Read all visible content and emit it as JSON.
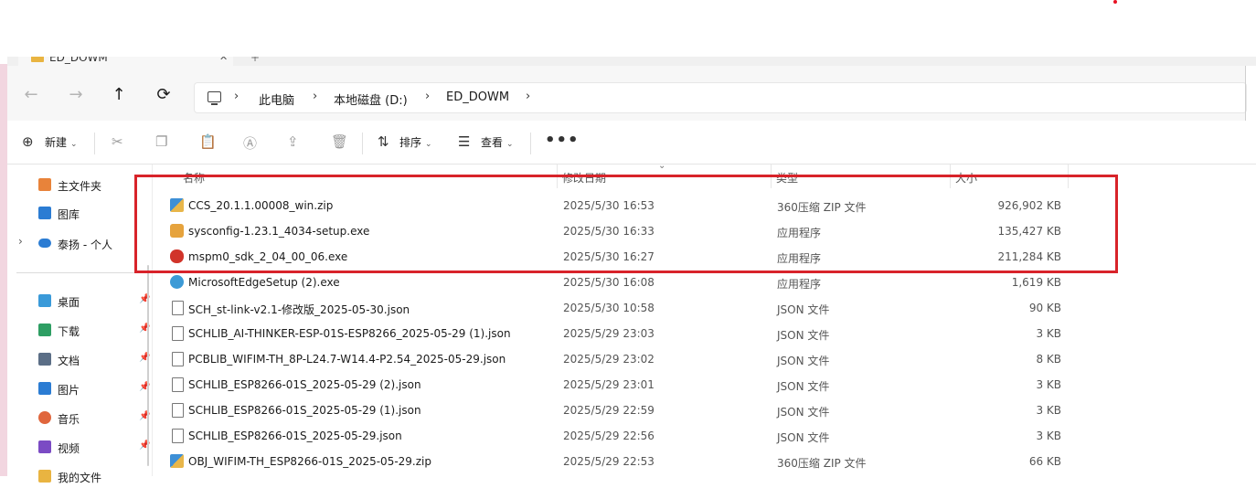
{
  "tab": {
    "title": "ED_DOWM",
    "close": "✕",
    "new_tab": "+"
  },
  "nav_buttons": {
    "back": "←",
    "forward": "→",
    "up": "↑",
    "refresh": "⟳"
  },
  "breadcrumb": {
    "items": [
      "此电脑",
      "本地磁盘 (D:)",
      "ED_DOWM"
    ],
    "separator": "›"
  },
  "toolbar": {
    "new_label": "新建",
    "sort_label": "排序",
    "view_label": "查看",
    "more_label": "•••",
    "icons": [
      "cut-icon",
      "copy-icon",
      "paste-icon",
      "rename-icon",
      "share-icon",
      "delete-icon"
    ]
  },
  "navpane": {
    "items": [
      {
        "label": "主文件夹",
        "icon": "home-icon",
        "color": "#e8833a"
      },
      {
        "label": "图库",
        "icon": "gallery-icon",
        "color": "#2b7cd3"
      },
      {
        "label": "泰扬 - 个人",
        "icon": "onedrive-icon",
        "color": "#2b7cd3"
      },
      {
        "label": "桌面",
        "icon": "desktop-icon",
        "color": "#3a9ad9"
      },
      {
        "label": "下载",
        "icon": "download-icon",
        "color": "#2e9e63"
      },
      {
        "label": "文档",
        "icon": "documents-icon",
        "color": "#5b6e86"
      },
      {
        "label": "图片",
        "icon": "pictures-icon",
        "color": "#2b7cd3"
      },
      {
        "label": "音乐",
        "icon": "music-icon",
        "color": "#e0663d"
      },
      {
        "label": "视频",
        "icon": "videos-icon",
        "color": "#7b4bc4"
      },
      {
        "label": "我的文件",
        "icon": "folder-icon",
        "color": "#e9b441"
      }
    ]
  },
  "columns": {
    "name": "名称",
    "date": "修改日期",
    "type": "类型",
    "size": "大小"
  },
  "files": [
    {
      "name": "CCS_20.1.1.00008_win.zip",
      "date": "2025/5/30 16:53",
      "type": "360压缩 ZIP 文件",
      "size": "926,902 KB",
      "icon": "zip"
    },
    {
      "name": "sysconfig-1.23.1_4034-setup.exe",
      "date": "2025/5/30 16:33",
      "type": "应用程序",
      "size": "135,427 KB",
      "icon": "exe1"
    },
    {
      "name": "mspm0_sdk_2_04_00_06.exe",
      "date": "2025/5/30 16:27",
      "type": "应用程序",
      "size": "211,284 KB",
      "icon": "exe2"
    },
    {
      "name": "MicrosoftEdgeSetup (2).exe",
      "date": "2025/5/30 16:08",
      "type": "应用程序",
      "size": "1,619 KB",
      "icon": "edge"
    },
    {
      "name": "SCH_st-link-v2.1-修改版_2025-05-30.json",
      "date": "2025/5/30 10:58",
      "type": "JSON 文件",
      "size": "90 KB",
      "icon": "json"
    },
    {
      "name": "SCHLIB_AI-THINKER-ESP-01S-ESP8266_2025-05-29 (1).json",
      "date": "2025/5/29 23:03",
      "type": "JSON 文件",
      "size": "3 KB",
      "icon": "json"
    },
    {
      "name": "PCBLIB_WIFIM-TH_8P-L24.7-W14.4-P2.54_2025-05-29.json",
      "date": "2025/5/29 23:02",
      "type": "JSON 文件",
      "size": "8 KB",
      "icon": "json"
    },
    {
      "name": "SCHLIB_ESP8266-01S_2025-05-29 (2).json",
      "date": "2025/5/29 23:01",
      "type": "JSON 文件",
      "size": "3 KB",
      "icon": "json"
    },
    {
      "name": "SCHLIB_ESP8266-01S_2025-05-29 (1).json",
      "date": "2025/5/29 22:59",
      "type": "JSON 文件",
      "size": "3 KB",
      "icon": "json"
    },
    {
      "name": "SCHLIB_ESP8266-01S_2025-05-29.json",
      "date": "2025/5/29 22:56",
      "type": "JSON 文件",
      "size": "3 KB",
      "icon": "json"
    },
    {
      "name": "OBJ_WIFIM-TH_ESP8266-01S_2025-05-29.zip",
      "date": "2025/5/29 22:53",
      "type": "360压缩 ZIP 文件",
      "size": "66 KB",
      "icon": "zip"
    }
  ]
}
